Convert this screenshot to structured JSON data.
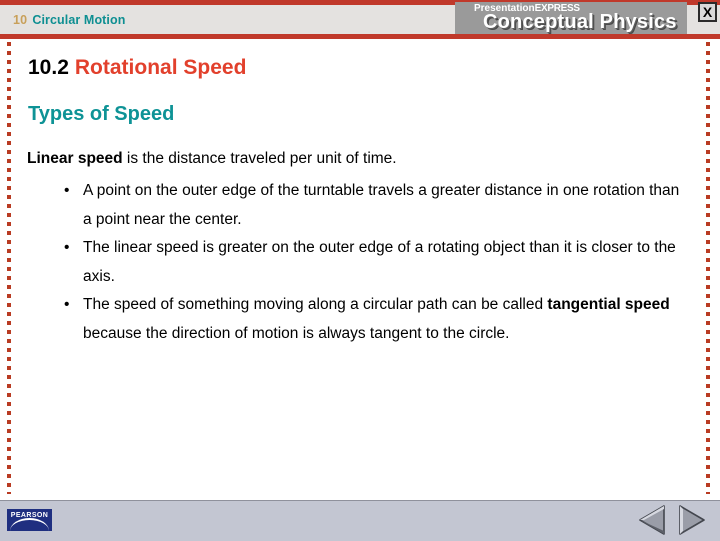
{
  "header": {
    "chapter_number": "10",
    "chapter_title": "Circular Motion",
    "brand_line1_regular": "Presentation",
    "brand_line1_bold": "EXPRESS",
    "brand_line2": "Conceptual Physics",
    "close_label": "X",
    "rule_color": "#c0392b",
    "band_color": "#e4e2e0",
    "chapter_number_color": "#c8a05a",
    "chapter_title_color": "#0e8f92",
    "banner_color": "#9a9a9a"
  },
  "slide": {
    "title_number": "10.2",
    "title_text": "Rotational Speed",
    "subtitle": "Types of Speed",
    "title_number_color": "#000000",
    "title_text_color": "#e2402c",
    "subtitle_color": "#0e9396",
    "lead_bold": "Linear speed",
    "lead_rest": " is the distance traveled per unit of time.",
    "bullet_glyph": "•",
    "bullets": [
      {
        "pre": "A point on the outer edge of the turntable travels a greater distance in one rotation than a point near the center.",
        "bold": "",
        "post": ""
      },
      {
        "pre": "The linear speed is greater on the outer edge of a rotating object than it is closer to the axis.",
        "bold": "",
        "post": ""
      },
      {
        "pre": "The speed of something moving along a circular path can be called ",
        "bold": "tangential speed",
        "post": " because the direction of motion is always tangent to the circle."
      }
    ],
    "border_dot_color": "#b93b22"
  },
  "footer": {
    "logo_text": "PEARSON",
    "logo_color": "#1f2f80",
    "bar_color": "#c3c6d2",
    "prev_label": "Previous slide",
    "next_label": "Next slide"
  }
}
